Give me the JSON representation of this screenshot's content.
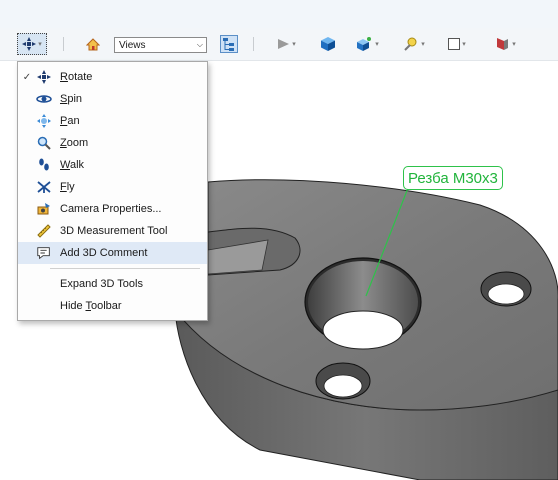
{
  "toolbar": {
    "views_value": "Views",
    "icons": [
      "navigation-tools-icon",
      "home-view-icon",
      "model-tree-icon",
      "play-animation-icon",
      "3d-object-icon",
      "lighting-icon",
      "background-color-icon",
      "part-color-icon",
      "cross-section-icon"
    ]
  },
  "menu": {
    "items": [
      {
        "label": "Rotate",
        "mnemonic": "R",
        "rest": "otate",
        "checked": true,
        "icon": "rotate-icon"
      },
      {
        "label": "Spin",
        "mnemonic": "S",
        "rest": "pin",
        "checked": false,
        "icon": "spin-icon"
      },
      {
        "label": "Pan",
        "mnemonic": "P",
        "rest": "an",
        "checked": false,
        "icon": "pan-icon"
      },
      {
        "label": "Zoom",
        "mnemonic": "Z",
        "rest": "oom",
        "checked": false,
        "icon": "zoom-icon"
      },
      {
        "label": "Walk",
        "mnemonic": "W",
        "rest": "alk",
        "checked": false,
        "icon": "walk-icon"
      },
      {
        "label": "Fly",
        "mnemonic": "F",
        "rest": "ly",
        "checked": false,
        "icon": "fly-icon"
      },
      {
        "label": "Camera Properties...",
        "icon": "camera-properties-icon"
      },
      {
        "label": "3D Measurement Tool",
        "icon": "measurement-tool-icon"
      },
      {
        "label": "Add 3D Comment",
        "icon": "add-comment-icon",
        "highlighted": true
      }
    ],
    "extra": [
      {
        "label": "Expand 3D Tools"
      },
      {
        "label": "Hide Toolbar",
        "pre": "Hide ",
        "mnemonic": "T",
        "rest": "oolbar"
      }
    ],
    "check_mark": "✓"
  },
  "annotation": {
    "text": "Резба M30x3",
    "color": "#22b43c"
  },
  "colors": {
    "model": "#7d7d7d",
    "highlight": "#dfe9f6",
    "toolbar": "#f3f6f9"
  }
}
